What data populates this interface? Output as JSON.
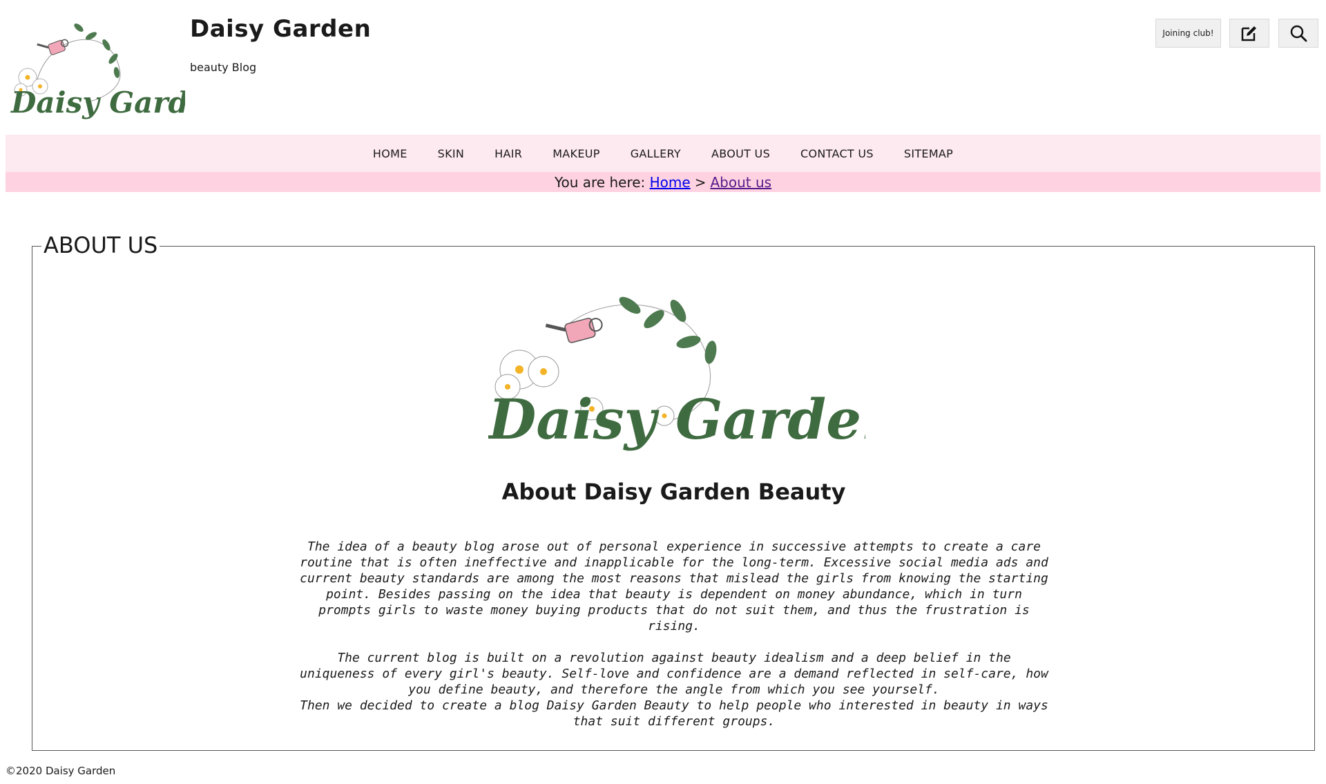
{
  "site": {
    "title": "Daisy Garden",
    "subtitle": "beauty Blog",
    "logo_text": "Daisy Garden"
  },
  "header_buttons": {
    "join_label": "Joining club!",
    "edit_icon": "edit-icon",
    "search_icon": "search-icon"
  },
  "nav": {
    "items": [
      "HOME",
      "SKIN",
      "HAIR",
      "MAKEUP",
      "GALLERY",
      "ABOUT US",
      "CONTACT US",
      "SITEMAP"
    ]
  },
  "breadcrumb": {
    "prefix": "You are here:",
    "home": "Home",
    "separator": ">",
    "current": "About us"
  },
  "section": {
    "legend": "ABOUT US",
    "heading": "About Daisy Garden Beauty",
    "paragraph1": "The idea of a beauty blog arose out of personal experience in successive attempts to create a care routine that is often ineffective and inapplicable for the long-term. Excessive social media ads and current beauty standards are among the most reasons that mislead the girls from knowing the starting point. Besides passing on the idea that beauty is dependent on money abundance, which in turn prompts girls to waste money buying products that do not suit them, and thus the frustration is rising.",
    "paragraph2": "The current blog is built on a revolution against beauty idealism and a deep belief in the uniqueness of every girl's beauty. Self-love and confidence are a demand reflected in self-care, how you define beauty, and therefore the angle from which you see yourself.",
    "paragraph3": "Then we decided to create a blog  Daisy Garden Beauty to help people who interested in beauty in ways that suit different groups."
  },
  "footer": {
    "copyright": "©2020 Daisy Garden"
  },
  "colors": {
    "nav_bg": "#fde9f0",
    "breadcrumb_bg": "#fed2e0",
    "logo_green": "#3f6b40",
    "watering_can_pink": "#f2a7b8"
  }
}
